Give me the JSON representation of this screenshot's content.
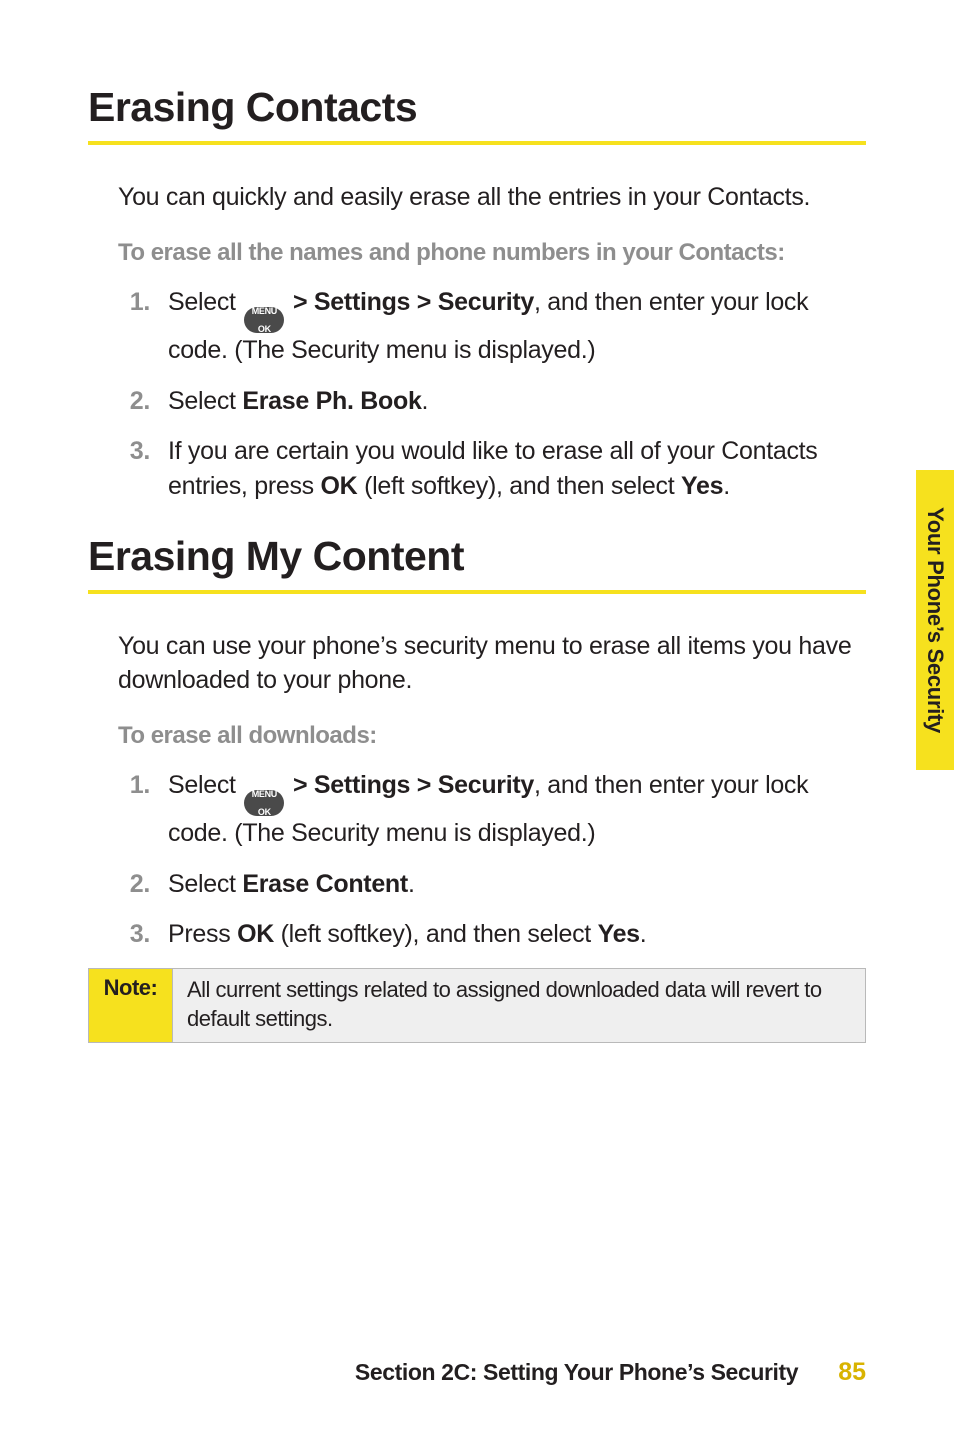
{
  "sidebar": {
    "label": "Your Phone’s Security"
  },
  "sec1": {
    "title": "Erasing Contacts",
    "intro": "You can quickly and easily erase all the entries in your Contacts.",
    "subhead": "To erase all the names and phone numbers in your Contacts:",
    "items": [
      {
        "n": "1.",
        "pre": "Select ",
        "icon_top": "MENU",
        "icon_bot": "OK",
        "mid": " > Settings > Security",
        "post": ", and then enter your lock code. (The Security menu is displayed.)"
      },
      {
        "n": "2.",
        "pre": "Select ",
        "bold": "Erase Ph. Book",
        "post": "."
      },
      {
        "n": "3.",
        "pre": "If you are certain you would like to erase all of your Contacts entries, press ",
        "bold": "OK",
        "mid": " (left softkey), and then select ",
        "bold2": "Yes",
        "post": "."
      }
    ]
  },
  "sec2": {
    "title": "Erasing My Content",
    "intro": "You can use your phone’s security menu to erase all items you have downloaded to your phone.",
    "subhead": "To erase all downloads:",
    "items": [
      {
        "n": "1.",
        "pre": "Select ",
        "icon_top": "MENU",
        "icon_bot": "OK",
        "mid": " > Settings > Security",
        "post": ", and then enter your lock code. (The Security menu is displayed.)"
      },
      {
        "n": "2.",
        "pre": "Select ",
        "bold": "Erase Content",
        "post": "."
      },
      {
        "n": "3.",
        "pre": "Press ",
        "bold": "OK",
        "mid": " (left softkey), and then select ",
        "bold2": "Yes",
        "post": "."
      }
    ]
  },
  "note": {
    "label": "Note:",
    "text": "All current settings related to assigned downloaded data will revert to default settings."
  },
  "footer": {
    "section": "Section 2C: Setting Your Phone’s Security",
    "page": "85"
  }
}
